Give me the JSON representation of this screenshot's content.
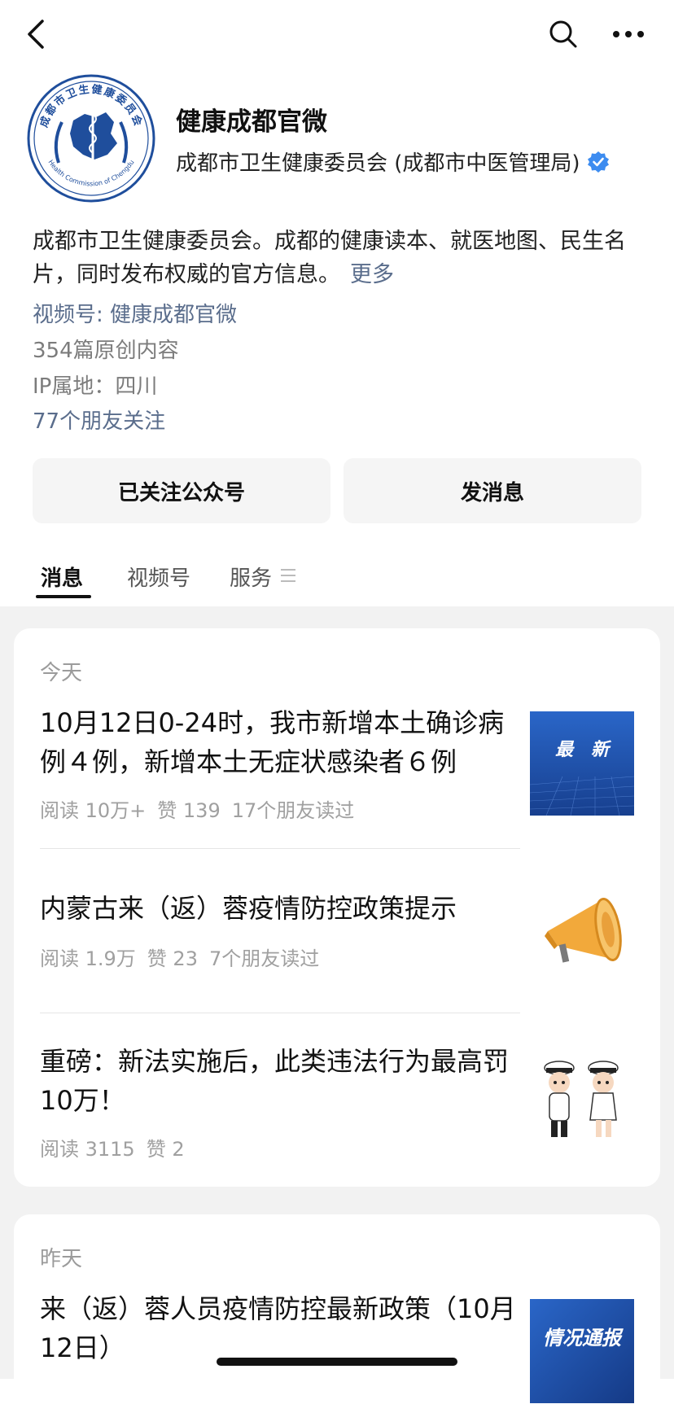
{
  "account": {
    "name": "健康成都官微",
    "org": "成都市卫生健康委员会 (成都市中医管理局)",
    "description": "成都市卫生健康委员会。成都的健康读本、就医地图、民生名片，同时发布权威的官方信息。",
    "more_label": "更多",
    "channels_link": "视频号: 健康成都官微",
    "original_count": "354篇原创内容",
    "ip_location": "IP属地：四川",
    "friends_following": "77个朋友关注",
    "logo_text_top": "成都市卫生健康委员会",
    "logo_text_bottom": "Health Commission of Chengdu"
  },
  "buttons": {
    "followed": "已关注公众号",
    "message": "发消息"
  },
  "tabs": [
    {
      "label": "消息"
    },
    {
      "label": "视频号"
    },
    {
      "label": "服务"
    }
  ],
  "feed": {
    "today": {
      "label": "今天",
      "articles": [
        {
          "title": "10月12日0-24时，我市新增本土确诊病例４例，新增本土无症状感染者６例",
          "reads": "阅读 10万+",
          "likes": "赞 139",
          "friends": "17个朋友读过",
          "thumb_text": "最　新"
        },
        {
          "title": "内蒙古来（返）蓉疫情防控政策提示",
          "reads": "阅读 1.9万",
          "likes": "赞 23",
          "friends": "7个朋友读过"
        },
        {
          "title": "重磅：新法实施后，此类违法行为最高罚10万！",
          "reads": "阅读 3115",
          "likes": "赞 2",
          "friends": ""
        }
      ]
    },
    "yesterday": {
      "label": "昨天",
      "articles": [
        {
          "title": "来（返）蓉人员疫情防控最新政策（10月12日）",
          "thumb_text": "情况通报"
        }
      ]
    }
  },
  "colors": {
    "link": "#5a6d8c",
    "verified": "#3d8cf0",
    "thumb_blue": "#1f56b8"
  }
}
